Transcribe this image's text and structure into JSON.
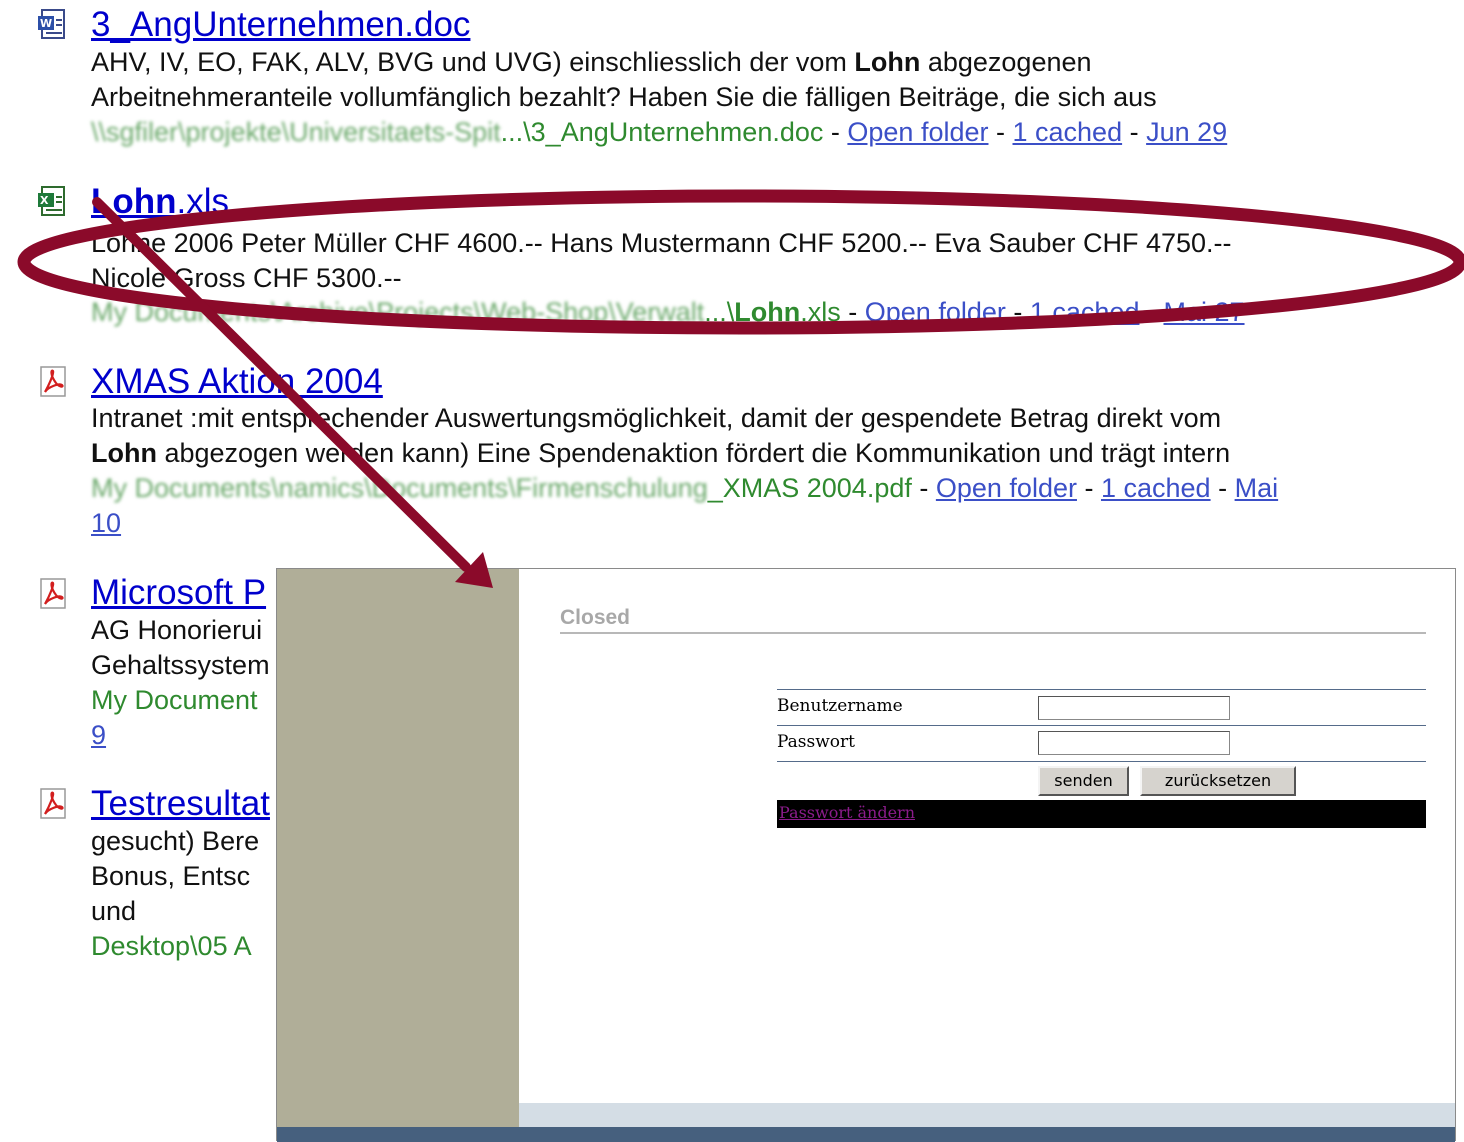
{
  "results": [
    {
      "icon": "word-doc-icon",
      "title": "3_AngUnternehmen.doc",
      "snippet_lines": [
        [
          "AHV, IV, EO, FAK, ALV, BVG und UVG) einschliesslich der vom ",
          "Lohn",
          " abgezogenen"
        ],
        [
          "Arbeitnehmeranteile vollumfänglich bezahlt? Haben Sie die fälligen Beiträge, die sich aus"
        ]
      ],
      "path_blur": "\\\\sgfiler\\projekte\\Universitaets-Spit",
      "path_clear": "...\\3_AngUnternehmen.doc",
      "open_folder": "Open folder",
      "cached": "1 cached",
      "date": "Jun 29"
    },
    {
      "icon": "excel-xls-icon",
      "title_bold": "Lohn",
      "title_rest": ".xls",
      "snippet_lines": [
        [
          "Löhne 2006 Peter Müller CHF 4600.-- Hans Mustermann CHF 5200.-- Eva Sauber CHF 4750.--"
        ],
        [
          "Nicole Gross CHF 5300.--"
        ]
      ],
      "path_blur": "My Documents\\Archive\\Projects\\Web-Shop\\Verwalt",
      "path_clear_pre": "...\\",
      "path_clear_bold": "Lohn",
      "path_clear_post": ".xls",
      "open_folder": "Open folder",
      "cached": "1 cached",
      "date": "Mai 27"
    },
    {
      "icon": "pdf-icon",
      "title": "XMAS Aktion 2004",
      "snippet_lines": [
        [
          "Intranet :mit entsprechender Auswertungsmöglichkeit, damit der gespendete Betrag direkt vom"
        ],
        [
          "",
          "Lohn",
          " abgezogen werden kann) Eine Spendenaktion fördert die Kommunikation und trägt intern"
        ]
      ],
      "path_blur": "My Documents\\namics\\Documents\\Firmenschulung",
      "path_clear": "_XMAS 2004.pdf",
      "open_folder": "Open folder",
      "cached": "1 cached",
      "date": "Mai",
      "date_line2": "10"
    },
    {
      "icon": "pdf-icon",
      "title": "Microsoft P",
      "snippet_lines": [
        [
          "AG Honorierui"
        ],
        [
          "Gehaltssystem"
        ]
      ],
      "path": "My Document",
      "extra": "9"
    },
    {
      "icon": "pdf-icon",
      "title": "Testresultat",
      "snippet_lines": [
        [
          "gesucht) Bere"
        ],
        [
          "Bonus, Entsc"
        ],
        [
          "und"
        ]
      ],
      "path": "Desktop\\05 A"
    }
  ],
  "login": {
    "heading": "Closed",
    "username_label": "Benutzername",
    "password_label": "Passwort",
    "username_value": "",
    "password_value": "",
    "submit_label": "senden",
    "reset_label": "zurücksetzen",
    "change_password_link": "Passwort ändern"
  },
  "annotation": {
    "color": "#8b0a2a",
    "ellipse": "highlight-ellipse",
    "arrow": "pointer-arrow"
  }
}
